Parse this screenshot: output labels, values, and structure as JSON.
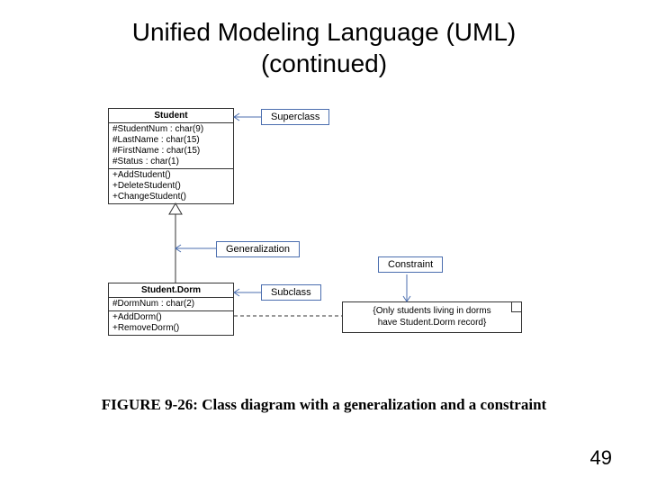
{
  "title_line1": "Unified Modeling Language (UML)",
  "title_line2": "(continued)",
  "labels": {
    "superclass": "Superclass",
    "generalization": "Generalization",
    "subclass": "Subclass",
    "constraint": "Constraint"
  },
  "student": {
    "name": "Student",
    "attrs": [
      "#StudentNum : char(9)",
      "#LastName : char(15)",
      "#FirstName : char(15)",
      "#Status : char(1)"
    ],
    "ops": [
      "+AddStudent()",
      "+DeleteStudent()",
      "+ChangeStudent()"
    ]
  },
  "studentDorm": {
    "name": "Student.Dorm",
    "attrs": [
      "#DormNum : char(2)"
    ],
    "ops": [
      "+AddDorm()",
      "+RemoveDorm()"
    ]
  },
  "note_line1": "{Only students living in dorms",
  "note_line2": "have Student.Dorm record}",
  "caption": "FIGURE 9-26: Class diagram with a generalization and a constraint",
  "page": "49"
}
